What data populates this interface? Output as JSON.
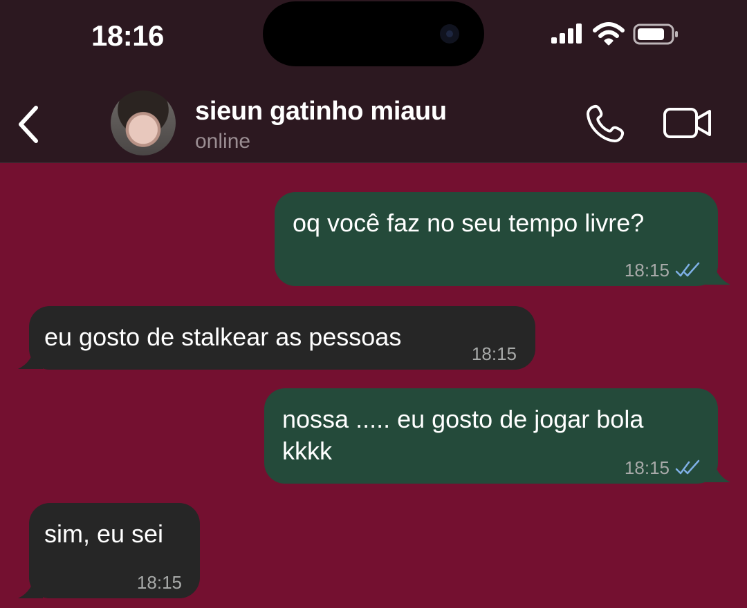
{
  "status_bar": {
    "time": "18:16",
    "icons": [
      "cellular-signal-icon",
      "wifi-icon",
      "battery-icon"
    ]
  },
  "header": {
    "back_icon": "chevron-left-icon",
    "contact_name": "sieun gatinho miauu",
    "contact_status": "online",
    "call_icon": "phone-icon",
    "video_icon": "video-camera-icon"
  },
  "colors": {
    "chat_background": "#741030",
    "header_background": "#2c1820",
    "outgoing_bubble": "#244a3a",
    "incoming_bubble": "#262626",
    "read_receipt": "#7fb0e6"
  },
  "messages": [
    {
      "direction": "outgoing",
      "text": "oq você faz no seu tempo livre?",
      "time": "18:15",
      "read": true
    },
    {
      "direction": "incoming",
      "text": "eu gosto de stalkear as pessoas",
      "time": "18:15"
    },
    {
      "direction": "outgoing",
      "text": "nossa ..... eu gosto de jogar bola",
      "text_line2": "kkkk",
      "time": "18:15",
      "read": true
    },
    {
      "direction": "incoming",
      "text": "sim, eu sei",
      "time": "18:15"
    }
  ]
}
